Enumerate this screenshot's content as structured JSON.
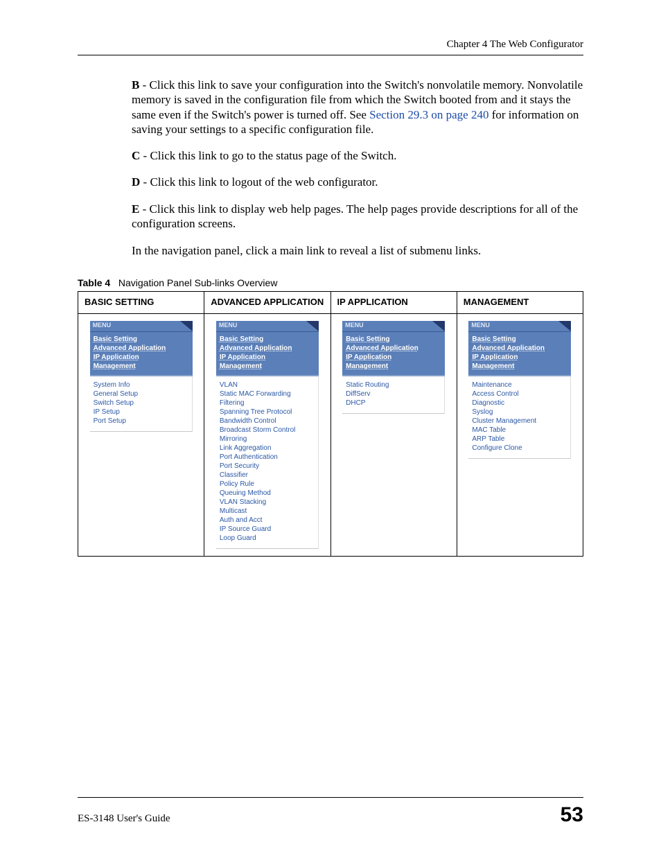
{
  "header": {
    "chapter": "Chapter 4 The Web Configurator"
  },
  "paragraphs": {
    "b_prefix": "B",
    "b_text1": " - Click this link to save your configuration into the Switch's nonvolatile memory. Nonvolatile memory is saved in the configuration file from which the Switch booted from and it stays the same even if the Switch's power is turned off. See ",
    "b_link": "Section 29.3 on page 240",
    "b_text2": " for information on saving your settings to a specific configuration file.",
    "c_prefix": "C",
    "c_text": " - Click this link to go to the status page of the Switch.",
    "d_prefix": "D",
    "d_text": " - Click this link to logout of the web configurator.",
    "e_prefix": "E",
    "e_text": " - Click this link to display web help pages. The help pages provide descriptions for all of the configuration screens.",
    "nav_intro": "In the navigation panel, click a main link to reveal a list of submenu links."
  },
  "table_caption": {
    "label": "Table 4",
    "title": "Navigation Panel Sub-links Overview"
  },
  "table_headers": {
    "c1": "BASIC SETTING",
    "c2": "ADVANCED APPLICATION",
    "c3": "IP APPLICATION",
    "c4": "MANAGEMENT"
  },
  "menu_label": "MENU",
  "main_nav": {
    "i1": "Basic Setting",
    "i2": "Advanced Application",
    "i3": "IP Application",
    "i4": "Management"
  },
  "basic_sub": {
    "s1": "System Info",
    "s2": "General Setup",
    "s3": "Switch Setup",
    "s4": "IP Setup",
    "s5": "Port Setup"
  },
  "advanced_sub": {
    "s1": "VLAN",
    "s2": "Static MAC Forwarding",
    "s3": "Filtering",
    "s4": "Spanning Tree Protocol",
    "s5": "Bandwidth Control",
    "s6": "Broadcast Storm Control",
    "s7": "Mirroring",
    "s8": "Link Aggregation",
    "s9": "Port Authentication",
    "s10": "Port Security",
    "s11": "Classifier",
    "s12": "Policy Rule",
    "s13": "Queuing Method",
    "s14": "VLAN Stacking",
    "s15": "Multicast",
    "s16": "Auth and Acct",
    "s17": "IP Source Guard",
    "s18": "Loop Guard"
  },
  "ip_sub": {
    "s1": "Static Routing",
    "s2": "DiffServ",
    "s3": "DHCP"
  },
  "mgmt_sub": {
    "s1": "Maintenance",
    "s2": "Access Control",
    "s3": "Diagnostic",
    "s4": "Syslog",
    "s5": "Cluster Management",
    "s6": "MAC Table",
    "s7": "ARP Table",
    "s8": "Configure Clone"
  },
  "footer": {
    "guide": "ES-3148 User's Guide",
    "page": "53"
  }
}
